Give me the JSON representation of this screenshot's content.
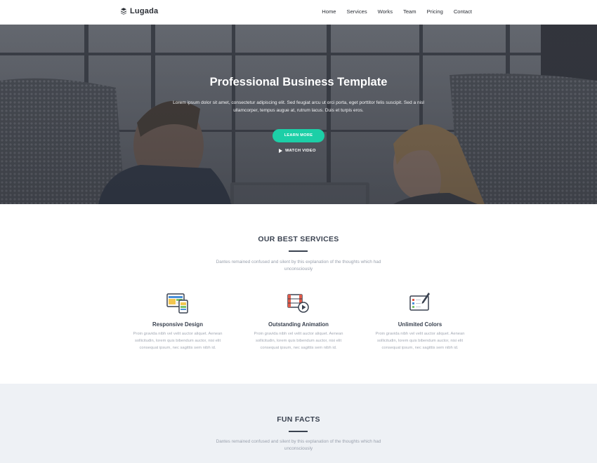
{
  "brand": {
    "name": "Lugada",
    "icon": "layers-icon"
  },
  "nav": [
    "Home",
    "Services",
    "Works",
    "Team",
    "Pricing",
    "Contact"
  ],
  "hero": {
    "title": "Professional Business Template",
    "text": "Lorem ipsum dolor sit amet, consectetur adipiscing elit. Sed feugiat arcu ut orci porta, eget porttitor felis suscipit. Sed a nisl ullamcorper, tempus augue at, rutrum lacus. Duis et turpis eros.",
    "learn_more": "LEARN MORE",
    "watch_video": "WATCH VIDEO",
    "accent": "#1ccfa7"
  },
  "services": {
    "title": "OUR BEST SERVICES",
    "subtitle": "Dantes remained confused and silent by this explanation of the thoughts which had unconsciously",
    "items": [
      {
        "icon": "responsive-devices-icon",
        "title": "Responsive Design",
        "text": "Proin gravida nibh vel velit auctor aliquet. Aenean sollicitudin, lorem quis bibendum auctor, nisi elit consequat ipsum, nec sagittis sem nibh id."
      },
      {
        "icon": "video-animation-icon",
        "title": "Outstanding Animation",
        "text": "Proin gravida nibh vel velit auctor aliquet. Aenean sollicitudin, lorem quis bibendum auctor, nisi elit consequat ipsum, nec sagittis sem nibh id."
      },
      {
        "icon": "color-tablet-icon",
        "title": "Unlimited Colors",
        "text": "Proin gravida nibh vel velit auctor aliquet. Aenean sollicitudin, lorem quis bibendum auctor, nisi elit consequat ipsum, nec sagittis sem nibh id."
      }
    ]
  },
  "facts": {
    "title": "FUN FACTS",
    "subtitle": "Dantes remained confused and silent by this explanation of the thoughts which had unconsciously"
  }
}
